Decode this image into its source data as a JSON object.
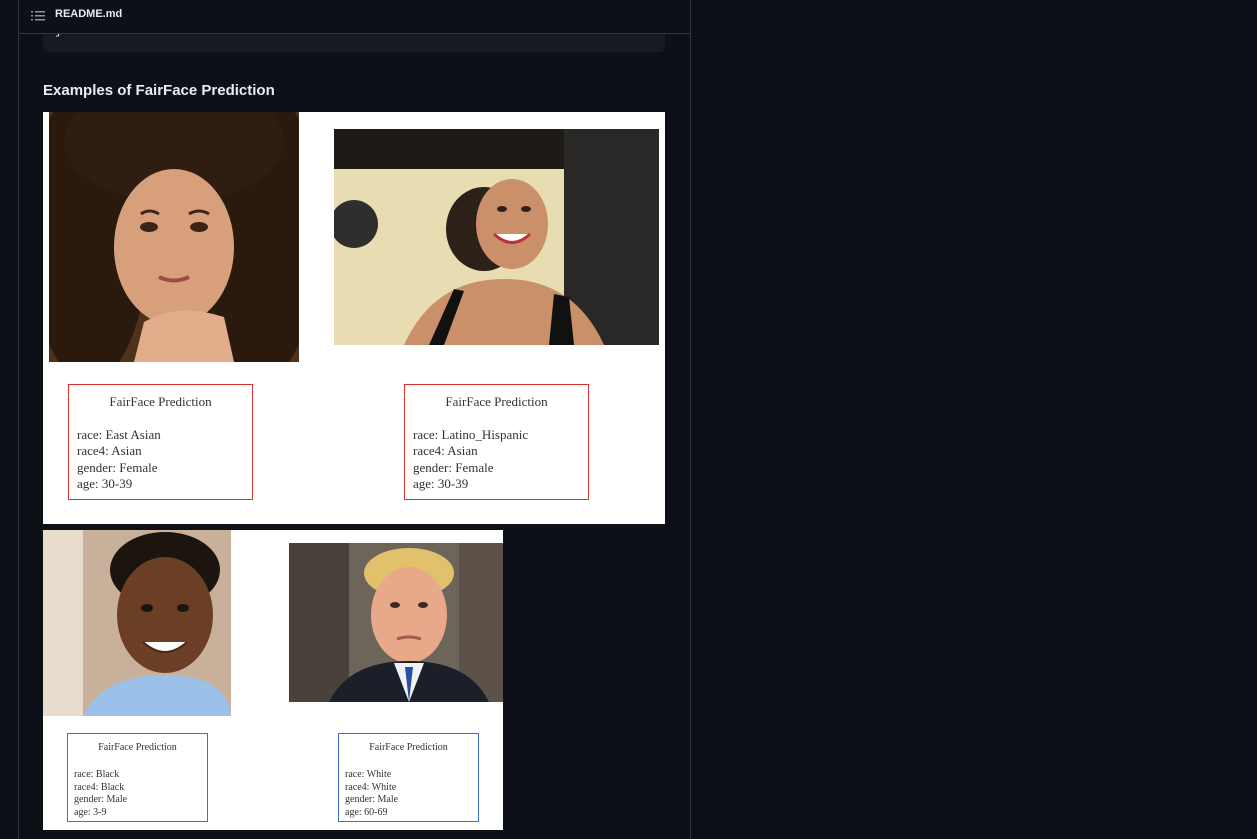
{
  "header": {
    "file_name": "README.md",
    "icon": "list-icon"
  },
  "code": {
    "last_line": "}"
  },
  "section": {
    "heading": "Examples of FairFace Prediction"
  },
  "figures": [
    {
      "predictions": [
        {
          "title": "FairFace Prediction",
          "race": "race: East Asian",
          "race4": "race4: Asian",
          "gender": "gender: Female",
          "age": "age: 30-39"
        },
        {
          "title": "FairFace Prediction",
          "race": "race: Latino_Hispanic",
          "race4": "race4: Asian",
          "gender": "gender: Female",
          "age": "age: 30-39"
        }
      ],
      "box_color": "#d9342b"
    },
    {
      "predictions": [
        {
          "title": "FairFace Prediction",
          "race": "race: Black",
          "race4": "race4: Black",
          "gender": "gender: Male",
          "age": "age: 3-9"
        },
        {
          "title": "FairFace Prediction",
          "race": "race: White",
          "race4": "race4: White",
          "gender": "gender: Male",
          "age": "age: 60-69"
        }
      ],
      "box_color": "#3f6fd1"
    }
  ],
  "colors": {
    "background": "#0d1117",
    "border": "#30363d",
    "code_bg": "#161b22",
    "text": "#e6edf3"
  }
}
